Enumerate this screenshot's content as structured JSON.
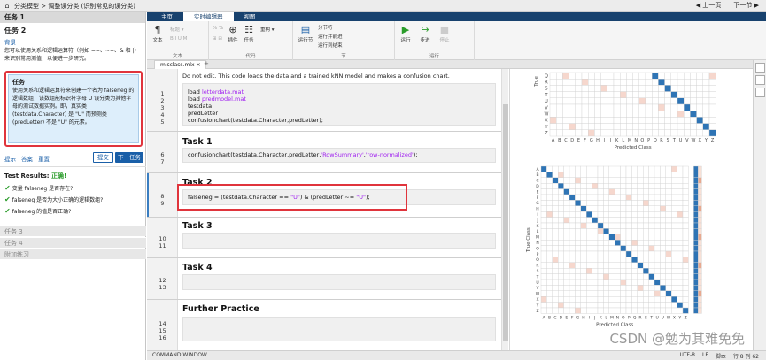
{
  "topbar": {
    "breadcrumb": "分类模型 > 调整误分类 (识别常见的误分类)",
    "prev": "上一页",
    "next": "下一节"
  },
  "left_panel": {
    "task1": "任务 1",
    "task2_header": "任务 2",
    "task2_title": "任务 2",
    "background_label": "背景",
    "background_text": "您可以使用关系和逻辑运算符（例如 ==、~=、& 和 |）来识别常用测值，以便进一步研究。",
    "task_box": {
      "title": "任务",
      "text": "使用关系和逻辑运算符来创建一个名为 falseneg 的逻辑数组，该数组能标识将字母 U 误分类为其他字母的测试数据实例。即，真实类 (testdata.Character) 是 \"U\" 而预测类 (predLetter) 不是 \"U\" 的元素。"
    },
    "links": [
      "提示",
      "答案",
      "重置"
    ],
    "submit_label": "提交",
    "next_task_label": "下一任务",
    "test_results_label": "Test Results:",
    "test_results_status": "正确!",
    "results": [
      "变量 falseneg 是否存在?",
      "falseneg 是否为大小正确的逻辑数组?",
      "falseneg 的值是否正确?"
    ],
    "task3": "任务 3",
    "task4": "任务 4",
    "further": "附加练习"
  },
  "tabs": [
    "主页",
    "实时编辑器",
    "视图"
  ],
  "ribbon": {
    "text_group": {
      "label": "文本",
      "btn": "文本",
      "dim": [
        "标题 ▾",
        "B I U M"
      ]
    },
    "code_group": {
      "label": "代码",
      "insert": "插件",
      "task": "任务",
      "refactor": "重构 ▾",
      "dim": [
        "% %",
        "⊞ ⊟"
      ]
    },
    "section_group": {
      "label": "节",
      "section": "运行节",
      "break": "分节符",
      "run_end": "运行并前进",
      "run_to_end": "运行到结束"
    },
    "run_group": {
      "label": "运行",
      "run": "运行",
      "step": "步进",
      "stop": "停止"
    }
  },
  "file_tab": "misclass.mlx",
  "editor": {
    "line_numbers_sec0": [
      "1",
      "2",
      "3",
      "4",
      "5"
    ],
    "comment": "Do not edit. This code loads the data and a trained kNN model and makes a confusion chart.",
    "sec0_code": [
      "load ",
      "letterdata.mat",
      "load ",
      "predmodel.mat",
      "testdata",
      "predLetter",
      "confusionchart(testdata.Character,predLetter);"
    ],
    "task1_title": "Task 1",
    "task1_lines": [
      "6",
      "7"
    ],
    "task1_code_a": "confusionchart(testdata.Character,predLetter,",
    "task1_code_s1": "'RowSummary'",
    "task1_code_c": ",",
    "task1_code_s2": "'row-normalized'",
    "task1_code_e": ");",
    "task2_title": "Task 2",
    "task2_lines": [
      "8",
      "9"
    ],
    "task2_code_a": "falseneg = (testdata.Character == ",
    "task2_code_s1": "\"U\"",
    "task2_code_b": ") & (predLetter ~= ",
    "task2_code_s2": "\"U\"",
    "task2_code_e": ");",
    "task3_title": "Task 3",
    "task3_lines": [
      "10",
      "11"
    ],
    "task4_title": "Task 4",
    "task4_lines": [
      "12",
      "13"
    ],
    "further_title": "Further Practice",
    "further_lines": [
      "14",
      "15",
      "16"
    ]
  },
  "plot_letters": [
    "A",
    "B",
    "C",
    "D",
    "E",
    "F",
    "G",
    "H",
    "I",
    "J",
    "K",
    "L",
    "M",
    "N",
    "O",
    "P",
    "Q",
    "R",
    "S",
    "T",
    "U",
    "V",
    "W",
    "X",
    "Y",
    "Z"
  ],
  "plot_top": {
    "row_letters": [
      "Q",
      "R",
      "S",
      "T",
      "U",
      "V",
      "W",
      "X",
      "Y",
      "Z"
    ],
    "xlabel": "Predicted Class",
    "ylabel": "True"
  },
  "plot_bottom": {
    "xlabel": "Predicted Class",
    "ylabel": "True Class"
  },
  "statusbar": {
    "left": "COMMAND WINDOW",
    "right": [
      "UTF-8",
      "LF",
      "脚本",
      "行 8 列 62"
    ]
  },
  "watermark": "CSDN @勉为其难免免",
  "colors": {
    "accent": "#18426e",
    "diag": "#2e74b5",
    "hilite": "#e0343c"
  }
}
